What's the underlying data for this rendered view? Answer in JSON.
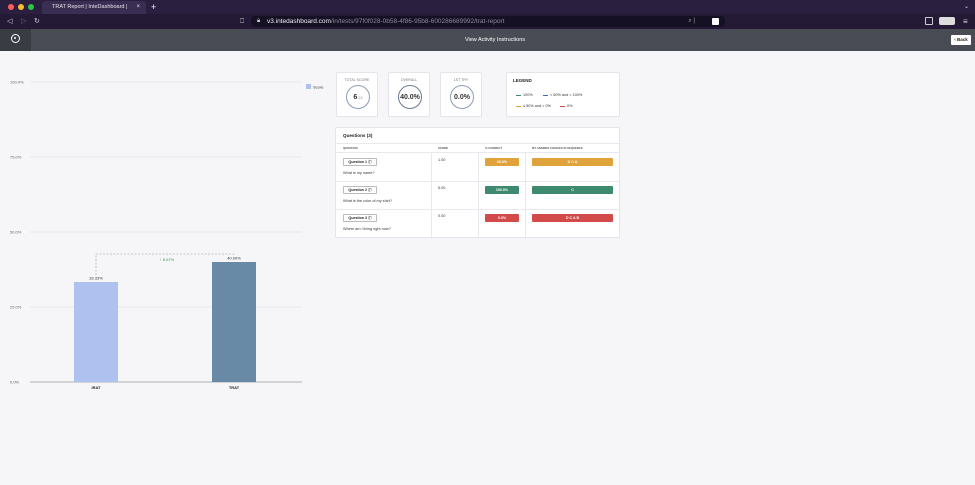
{
  "browser": {
    "tab_title": "TRAT Report | InteDashboard |",
    "tab_close": "×",
    "new_tab": "+",
    "url_host": "v3.intedashboard.com",
    "url_path": "/in/tests/97f0f028-0b58-4f86-95b8-600286689992/trat-report",
    "traffic_colors": [
      "#ff5f57",
      "#febc2e",
      "#28c840"
    ]
  },
  "header": {
    "instructions_link": "View Activity Instructions",
    "back_button": "‹ Back"
  },
  "stats": {
    "total_score": {
      "label": "TOTAL SCORE",
      "value": "6",
      "sub": "/15"
    },
    "overall": {
      "label": "OVERALL",
      "value": "40.0%"
    },
    "first_try": {
      "label": "1ST TRY",
      "value": "0.0%"
    }
  },
  "legend": {
    "title": "LEGEND",
    "items": [
      {
        "label": "100%",
        "color": "#3d8a6e"
      },
      {
        "label": "< 50% and < 100%",
        "color": "#3b6fb6"
      },
      {
        "label": "≤ 50% and > 0%",
        "color": "#e0a23a"
      },
      {
        "label": "0%",
        "color": "#d34a4a"
      }
    ]
  },
  "questions": {
    "title": "Questions (3)",
    "columns": [
      "QUESTION",
      "SCORE",
      "% CORRECT",
      "MY ANSWER CHOICES IN SEQUENCE"
    ],
    "rows": [
      {
        "button": "Question 1 ⓘ",
        "text": "What is my name?",
        "score": "1.00",
        "percent": "20.0%",
        "answers": "D C A",
        "color": "#e0a23a"
      },
      {
        "button": "Question 2 ⓘ",
        "text": "What is the color of my shirt?",
        "score": "5.00",
        "percent": "100.0%",
        "answers": "C",
        "color": "#3d8a6e"
      },
      {
        "button": "Question 3 ⓘ",
        "text": "Where am i living right now?",
        "score": "0.00",
        "percent": "0.0%",
        "answers": "D C A B",
        "color": "#d34a4a"
      }
    ]
  },
  "chart_data": {
    "type": "bar",
    "categories": [
      "IRAT",
      "TRAT"
    ],
    "values": [
      33.33,
      40.0
    ],
    "value_labels": [
      "33.33%",
      "40.00%"
    ],
    "colors": [
      "#afc1ee",
      "#688aa6"
    ],
    "ylim": [
      0,
      100
    ],
    "yticks": [
      "0.0%",
      "25.0%",
      "50.0%",
      "75.0%",
      "100.0%"
    ],
    "tick_values": [
      0,
      25,
      50,
      75,
      100
    ],
    "legend": "Score",
    "legend_color": "#afc1ee",
    "legend_position": "top-right",
    "annotation": "↑ 6.67%",
    "annotation_color": "#3c9a4e"
  }
}
